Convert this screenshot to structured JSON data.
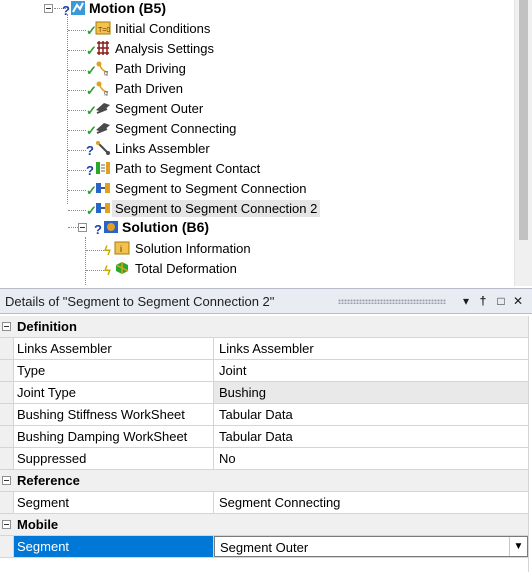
{
  "tree": {
    "root": {
      "label": "Motion (B5)",
      "status": "?"
    },
    "children": [
      {
        "label": "Initial Conditions",
        "status": "✓",
        "icon": "initial-conditions-icon"
      },
      {
        "label": "Analysis Settings",
        "status": "✓",
        "icon": "analysis-settings-icon"
      },
      {
        "label": "Path Driving",
        "status": "✓",
        "icon": "path-driving-icon"
      },
      {
        "label": "Path Driven",
        "status": "✓",
        "icon": "path-driven-icon"
      },
      {
        "label": "Segment Outer",
        "status": "✓",
        "icon": "segment-outer-icon"
      },
      {
        "label": "Segment Connecting",
        "status": "✓",
        "icon": "segment-connecting-icon"
      },
      {
        "label": "Links Assembler",
        "status": "?",
        "icon": "links-assembler-icon"
      },
      {
        "label": "Path to Segment Contact",
        "status": "?",
        "icon": "contact-icon"
      },
      {
        "label": "Segment to Segment Connection",
        "status": "✓",
        "icon": "joint-icon"
      },
      {
        "label": "Segment to Segment Connection 2",
        "status": "✓",
        "icon": "joint-icon"
      }
    ],
    "solution": {
      "label": "Solution (B6)",
      "status": "?"
    },
    "solution_children": [
      {
        "label": "Solution Information",
        "status": "ϟ",
        "icon": "solution-information-icon"
      },
      {
        "label": "Total Deformation",
        "status": "ϟ",
        "icon": "total-deformation-icon"
      }
    ]
  },
  "details": {
    "title": "Details of \"Segment to Segment Connection 2\"",
    "controls": {
      "dropdown": "▾",
      "pin": "†",
      "maximize": "□",
      "close": "✕"
    },
    "sections": [
      {
        "label": "Definition",
        "rows": [
          {
            "name": "Links Assembler",
            "value": "Links Assembler"
          },
          {
            "name": "Type",
            "value": "Joint"
          },
          {
            "name": "Joint Type",
            "value": "Bushing"
          },
          {
            "name": "Bushing Stiffness WorkSheet",
            "value": "Tabular Data"
          },
          {
            "name": "Bushing Damping WorkSheet",
            "value": "Tabular Data"
          },
          {
            "name": "Suppressed",
            "value": "No"
          }
        ]
      },
      {
        "label": "Reference",
        "rows": [
          {
            "name": "Segment",
            "value": "Segment Connecting"
          }
        ]
      },
      {
        "label": "Mobile",
        "rows": [
          {
            "name": "Segment",
            "value": "Segment Outer"
          }
        ]
      }
    ]
  },
  "colors": {
    "selection": "#0078d7",
    "ok": "#2f9d2f",
    "question": "#1f3fa8",
    "lightning": "#c8a800"
  }
}
